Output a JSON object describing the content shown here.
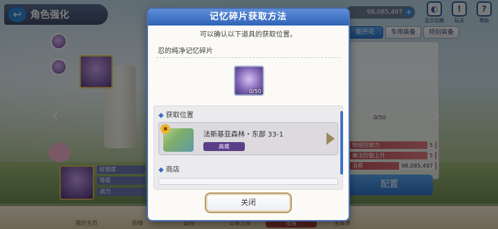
{
  "background": {
    "title": "角色强化",
    "currency": "98,085,497",
    "top_icons": [
      {
        "icon": "display-toggle-icon",
        "label": "显示切换"
      },
      {
        "icon": "mode-icon",
        "label": "玩法"
      },
      {
        "icon": "help-icon",
        "label": "帮助"
      }
    ],
    "tabs": [
      "能开花",
      "专用装备",
      "特别装备"
    ],
    "stats": [
      {
        "label": "物理防御力",
        "value": "5"
      },
      {
        "label": "魔法防御上升",
        "value": "5"
      },
      {
        "label": "消费",
        "value": "98,085,497"
      }
    ],
    "progress": "0/50",
    "left_info": [
      "好感度",
      "等级",
      "战力"
    ],
    "configure_button": "配置",
    "bottom_nav": [
      "我的主页",
      "剧情",
      "冒险",
      "公会之家",
      "扭蛋",
      "主菜单"
    ]
  },
  "modal": {
    "title": "记忆碎片获取方法",
    "subtitle": "可以确认以下道具的获取位置。",
    "item_name": "忍的纯净记忆碎片",
    "item_count": "0/50",
    "source_section": "获取位置",
    "sources": [
      {
        "stage": "法斯基亚森林・东部 33-1",
        "difficulty": "高难"
      }
    ],
    "shop_section": "商店",
    "close_button": "关闭"
  }
}
